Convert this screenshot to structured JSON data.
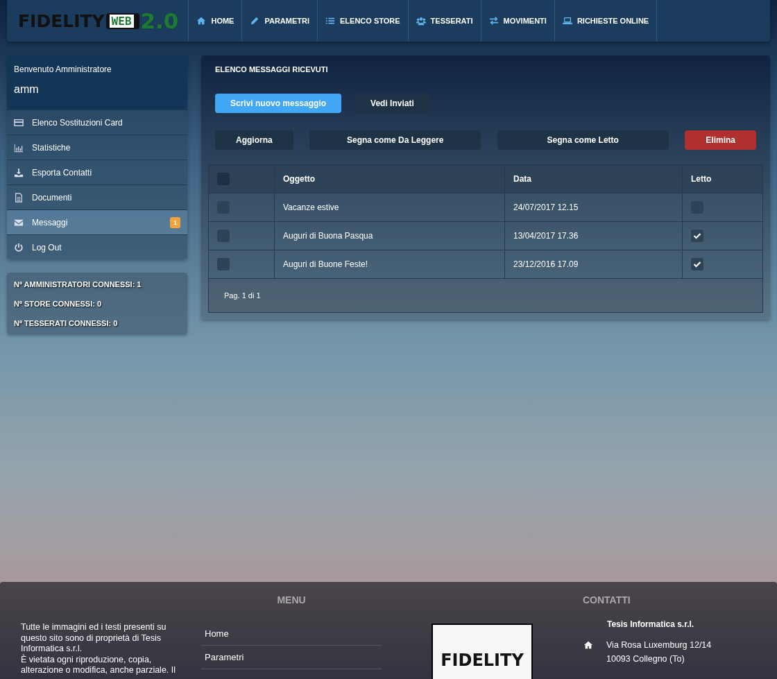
{
  "header": {
    "logo": {
      "word": "FIDELITY",
      "screen": "WEB",
      "version": "2.0"
    },
    "nav": [
      {
        "label": "HOME"
      },
      {
        "label": "PARAMETRI"
      },
      {
        "label": "ELENCO STORE"
      },
      {
        "label": "TESSERATI"
      },
      {
        "label": "MOVIMENTI"
      },
      {
        "label": "RICHIESTE ONLINE"
      }
    ]
  },
  "sidebar": {
    "welcome": "Benvenuto Amministratore",
    "user": "amm",
    "items": [
      {
        "label": "Elenco Sostituzioni Card",
        "selected": false
      },
      {
        "label": "Statistiche",
        "selected": false
      },
      {
        "label": "Esporta Contatti",
        "selected": false
      },
      {
        "label": "Documenti",
        "selected": false
      },
      {
        "label": "Messaggi",
        "selected": true,
        "badge": "1"
      },
      {
        "label": "Log Out",
        "selected": false
      }
    ],
    "stats": [
      "Nº AMMINISTRATORI CONNESSI: 1",
      "Nº STORE CONNESSI: 0",
      "Nº TESSERATI CONNESSI: 0"
    ]
  },
  "panel": {
    "title": "ELENCO MESSAGGI RICEVUTI",
    "top_buttons": [
      {
        "label": "Scrivi nuovo messaggio",
        "kind": "primary"
      },
      {
        "label": "Vedi Inviati",
        "kind": "dark"
      }
    ],
    "action_buttons": [
      {
        "label": "Aggiorna",
        "kind": "dark"
      },
      {
        "label": "Segna come Da Leggere",
        "kind": "dark"
      },
      {
        "label": "Segna come Letto",
        "kind": "dark"
      },
      {
        "label": "Elimina",
        "kind": "danger"
      }
    ],
    "table": {
      "select_all_checked": false,
      "columns": [
        "Oggetto",
        "Data",
        "Letto"
      ],
      "rows": [
        {
          "checked": false,
          "subject": "Vacanze estive",
          "date": "24/07/2017 12.15",
          "read": false
        },
        {
          "checked": false,
          "subject": "Auguri di Buona Pasqua",
          "date": "13/04/2017 17.36",
          "read": true
        },
        {
          "checked": false,
          "subject": "Auguri di Buone Feste!",
          "date": "23/12/2016 17.09",
          "read": true
        }
      ],
      "pagination": "Pag. 1 di 1"
    }
  },
  "footer": {
    "disclaimer": [
      "Tutte le immagini ed i testi presenti su questo sito sono di proprietà di Tesis Informatica s.r.l.",
      "È vietata ogni riproduzione, copia, alterazione o modifica, anche parziale. Il"
    ],
    "menu_heading": "MENU",
    "menu": [
      "Home",
      "Parametri"
    ],
    "logo": {
      "word": "FIDELITY"
    },
    "contacts_heading": "CONTATTI",
    "company": "Tesis Informatica s.r.l.",
    "address": [
      "Via Rosa Luxemburg 12/14",
      "10093 Collegno (To)"
    ]
  }
}
